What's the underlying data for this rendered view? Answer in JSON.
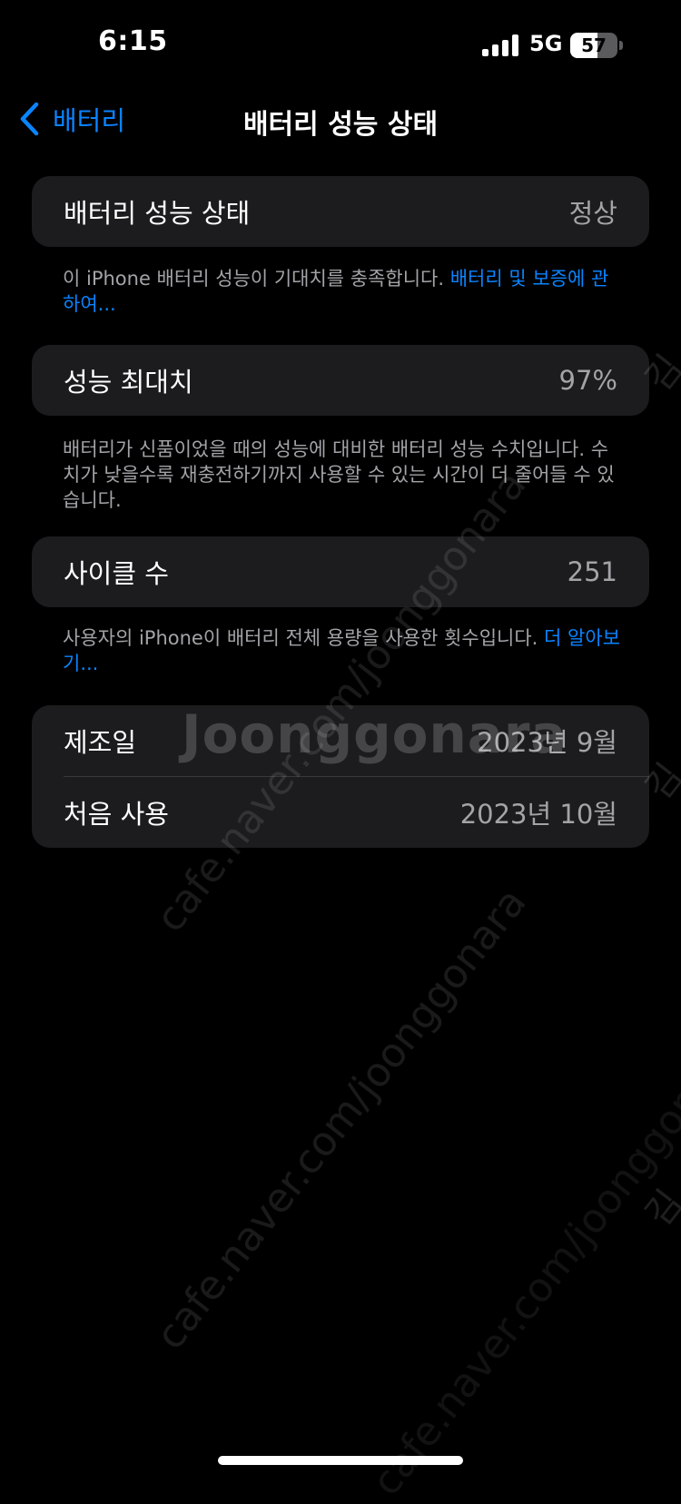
{
  "status_bar": {
    "time": "6:15",
    "network": "5G",
    "battery_level": "57",
    "battery_fraction": 0.57
  },
  "nav": {
    "back_label": "배터리",
    "title": "배터리 성능 상태"
  },
  "battery_health": {
    "label": "배터리 성능 상태",
    "value": "정상",
    "footnote_text": "이 iPhone 배터리 성능이 기대치를 충족합니다. ",
    "footnote_link": "배터리 및 보증에 관하여..."
  },
  "max_capacity": {
    "label": "성능 최대치",
    "value": "97%",
    "footnote_text": "배터리가 신품이었을 때의 성능에 대비한 배터리 성능 수치입니다. 수치가 낮을수록 재충전하기까지 사용할 수 있는 시간이 더 줄어들 수 있습니다."
  },
  "cycle_count": {
    "label": "사이클 수",
    "value": "251",
    "footnote_text": "사용자의 iPhone이 배터리 전체 용량을 사용한 횟수입니다. ",
    "footnote_link": "더 알아보기..."
  },
  "dates": {
    "manufacture_label": "제조일",
    "manufacture_value": "2023년 9월",
    "first_use_label": "처음 사용",
    "first_use_value": "2023년 10월"
  },
  "watermark": {
    "logo": "Joonggonara",
    "url": "cafe.naver.com/joonggonara",
    "side": "김"
  },
  "colors": {
    "accent": "#0a84ff",
    "cell_background": "#1c1c1e",
    "secondary_text": "#a3a3a8"
  },
  "icons": {
    "back": "chevron-left-icon",
    "signal": "cellular-signal-icon",
    "battery": "battery-icon"
  }
}
